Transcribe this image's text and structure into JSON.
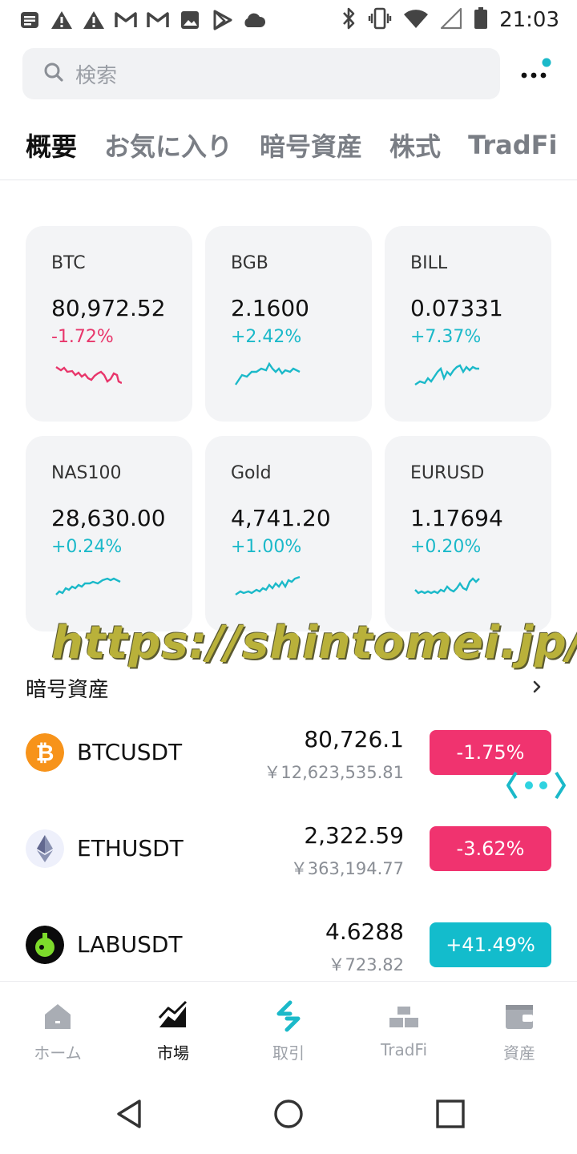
{
  "status_bar": {
    "time": "21:03",
    "left_icons": [
      "notification-icon",
      "warning-icon",
      "warning-icon",
      "gmail-icon",
      "gmail-icon",
      "image-icon",
      "play-icon",
      "cloud-icon"
    ],
    "right_icons": [
      "bluetooth-icon",
      "vibrate-icon",
      "wifi-icon",
      "signal-icon",
      "battery-icon"
    ]
  },
  "search": {
    "placeholder": "検索",
    "icon": "search-icon"
  },
  "menu": {
    "icon": "more-icon",
    "badge_color": "#1bb9c9"
  },
  "tabs": [
    {
      "label": "概要",
      "active": true
    },
    {
      "label": "お気に入り",
      "active": false
    },
    {
      "label": "暗号資産",
      "active": false
    },
    {
      "label": "株式",
      "active": false
    },
    {
      "label": "TradFi",
      "active": false
    }
  ],
  "cards": [
    {
      "symbol": "BTC",
      "price": "80,972.52",
      "change": "-1.72%",
      "direction": "down"
    },
    {
      "symbol": "BGB",
      "price": "2.1600",
      "change": "+2.42%",
      "direction": "up"
    },
    {
      "symbol": "BILL",
      "price": "0.07331",
      "change": "+7.37%",
      "direction": "up"
    },
    {
      "symbol": "NAS100",
      "price": "28,630.00",
      "change": "+0.24%",
      "direction": "up"
    },
    {
      "symbol": "Gold",
      "price": "4,741.20",
      "change": "+1.00%",
      "direction": "up"
    },
    {
      "symbol": "EURUSD",
      "price": "1.17694",
      "change": "+0.20%",
      "direction": "up"
    }
  ],
  "watermark": "https://shintomei.jp/",
  "section": {
    "title": "暗号資産"
  },
  "list": [
    {
      "pair": "BTCUSDT",
      "price": "80,726.1",
      "jpy": "￥12,623,535.81",
      "change": "-1.75%",
      "direction": "down",
      "icon": "bitcoin-icon"
    },
    {
      "pair": "ETHUSDT",
      "price": "2,322.59",
      "jpy": "￥363,194.77",
      "change": "-3.62%",
      "direction": "down",
      "icon": "ethereum-icon"
    },
    {
      "pair": "LABUSDT",
      "price": "4.6288",
      "jpy": "￥723.82",
      "change": "+41.49%",
      "direction": "up",
      "icon": "lab-icon"
    }
  ],
  "bottom_nav": [
    {
      "label": "ホーム",
      "icon": "home-icon",
      "active": false
    },
    {
      "label": "市場",
      "icon": "market-icon",
      "active": true
    },
    {
      "label": "取引",
      "icon": "trade-icon",
      "active": false
    },
    {
      "label": "TradFi",
      "icon": "tradfi-icon",
      "active": false
    },
    {
      "label": "資産",
      "icon": "wallet-icon",
      "active": false
    }
  ],
  "colors": {
    "up": "#1bb9c9",
    "down": "#e8366b",
    "pill_up": "#13bccc",
    "pill_down": "#f0336f"
  }
}
